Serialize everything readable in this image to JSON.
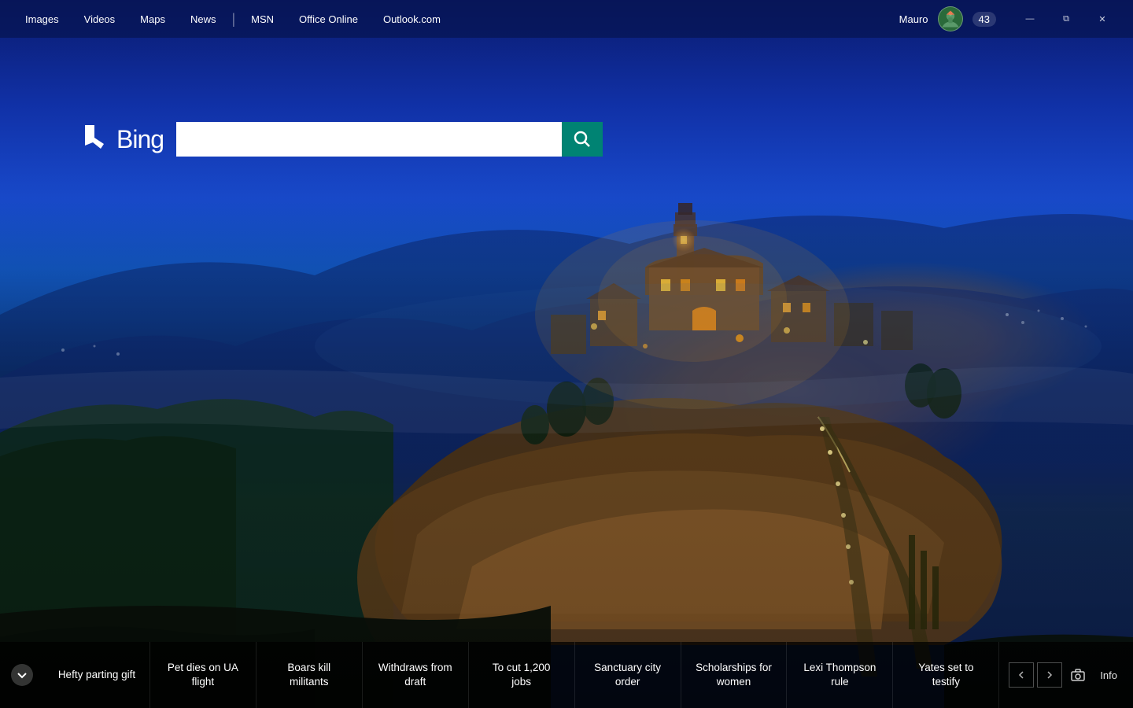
{
  "nav": {
    "links": [
      {
        "id": "images",
        "label": "Images"
      },
      {
        "id": "videos",
        "label": "Videos"
      },
      {
        "id": "maps",
        "label": "Maps"
      },
      {
        "id": "news",
        "label": "News"
      },
      {
        "id": "msn",
        "label": "MSN"
      },
      {
        "id": "office",
        "label": "Office Online"
      },
      {
        "id": "outlook",
        "label": "Outlook.com"
      }
    ],
    "user": "Mauro",
    "notification_count": "43"
  },
  "search": {
    "logo_text": "Bing",
    "placeholder": "",
    "button_icon": "🔍"
  },
  "window_controls": {
    "minimize": "—",
    "maximize": "⧉",
    "close": "✕"
  },
  "bottom_bar": {
    "news_items": [
      {
        "id": "hefty-parting",
        "text": "Hefty parting gift"
      },
      {
        "id": "pet-flight",
        "text": "Pet dies on UA flight"
      },
      {
        "id": "boars-militants",
        "text": "Boars kill militants"
      },
      {
        "id": "withdraws-draft",
        "text": "Withdraws from draft"
      },
      {
        "id": "cut-jobs",
        "text": "To cut 1,200 jobs"
      },
      {
        "id": "sanctuary-city",
        "text": "Sanctuary city order"
      },
      {
        "id": "scholarships-women",
        "text": "Scholarships for women"
      },
      {
        "id": "lexi-rule",
        "text": "Lexi Thompson rule"
      },
      {
        "id": "yates-testify",
        "text": "Yates set to testify"
      }
    ],
    "info_label": "Info",
    "toggle_icon": "▾"
  }
}
